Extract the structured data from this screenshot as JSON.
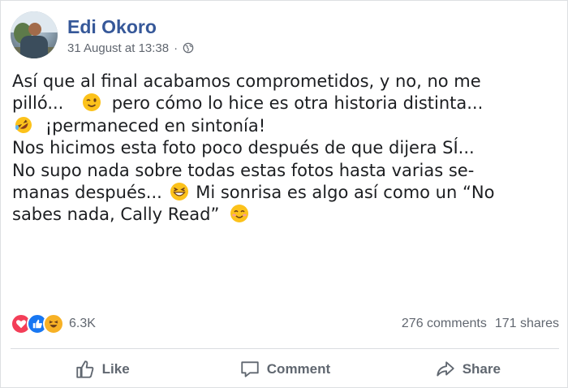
{
  "post": {
    "author": "Edi Okoro",
    "timestamp": "31 August at 13:38",
    "separator": "·",
    "privacy_icon": "globe-icon",
    "lines": {
      "l1": "Así que al final acabamos comprometidos, y no, no me",
      "l2a": "pilló...",
      "l2b": "pero cómo lo hice es otra historia distinta...",
      "l3": "¡permaneced en sintonía!",
      "l4": "Nos hicimos esta foto poco después de que dijera SÍ...",
      "l5": "No supo nada sobre todas estas fotos hasta varias se-",
      "l6a": "manas después...",
      "l6b": "Mi sonrisa es algo así como un “No",
      "l7": "sabes nada, Cally Read”"
    },
    "emojis": [
      "winking-face-emoji",
      "rolling-on-floor-laughing-emoji",
      "grinning-squinting-face-emoji",
      "smiling-face-emoji"
    ]
  },
  "stats": {
    "reactions": [
      "love-reaction-icon",
      "like-reaction-icon",
      "haha-reaction-icon"
    ],
    "reaction_count": "6.3K",
    "comments": "276 comments",
    "shares": "171 shares"
  },
  "actions": {
    "like": "Like",
    "comment": "Comment",
    "share": "Share"
  },
  "colors": {
    "author_blue": "#365899",
    "secondary_text": "#616770",
    "love": "#f33e58",
    "like": "#1877f2",
    "haha": "#f7b125"
  }
}
